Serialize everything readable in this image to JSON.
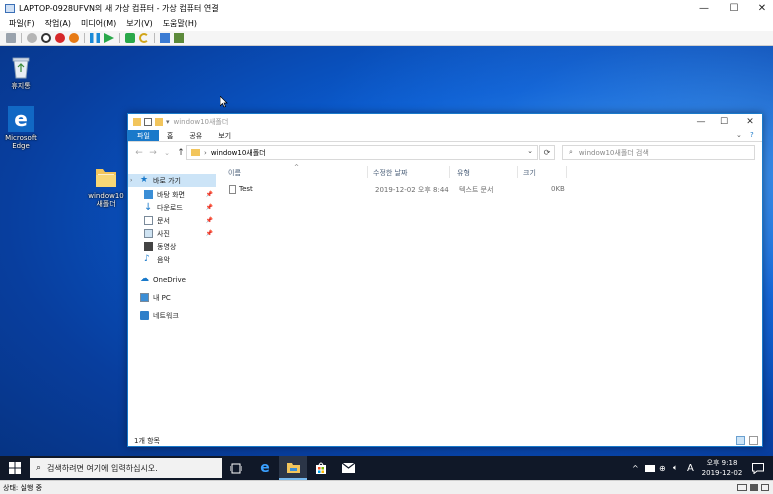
{
  "host_window": {
    "title": "LAPTOP-0928UFVN의 새 가상 컴퓨터 - 가상 컴퓨터 연결",
    "minimize": "—",
    "maximize": "☐",
    "close": "✕",
    "menu": [
      "파일(F)",
      "작업(A)",
      "미디어(M)",
      "보기(V)",
      "도움말(H)"
    ],
    "status": "상태: 실행 중"
  },
  "desktop": {
    "icons": [
      {
        "name": "recycle-bin",
        "label": "휴지통"
      },
      {
        "name": "microsoft-edge",
        "label": "Microsoft Edge"
      },
      {
        "name": "folder",
        "label": "window10새폴더"
      }
    ]
  },
  "explorer": {
    "title": "window10새폴더",
    "tabs": [
      "파일",
      "홈",
      "공유",
      "보기"
    ],
    "address": "window10새폴더",
    "search_placeholder": "window10새폴더 검색",
    "nav": {
      "quick_access": "바로 가기",
      "items": [
        "바탕 화면",
        "다운로드",
        "문서",
        "사진",
        "동영상",
        "음악"
      ],
      "onedrive": "OneDrive",
      "this_pc": "내 PC",
      "network": "네트워크"
    },
    "columns": [
      "이름",
      "수정한 날짜",
      "유형",
      "크기"
    ],
    "files": [
      {
        "name": "Test",
        "modified": "2019-12-02 오후 8:44",
        "type": "텍스트 문서",
        "size": "0KB"
      }
    ],
    "status": "1개 항목"
  },
  "taskbar": {
    "search_placeholder": "검색하려면 여기에 입력하십시오.",
    "time": "오후 9:18",
    "date": "2019-12-02",
    "ime": "A"
  },
  "colors": {
    "accent": "#1979ca",
    "desktop": "#0a5cd0",
    "taskbar": "#101828"
  }
}
